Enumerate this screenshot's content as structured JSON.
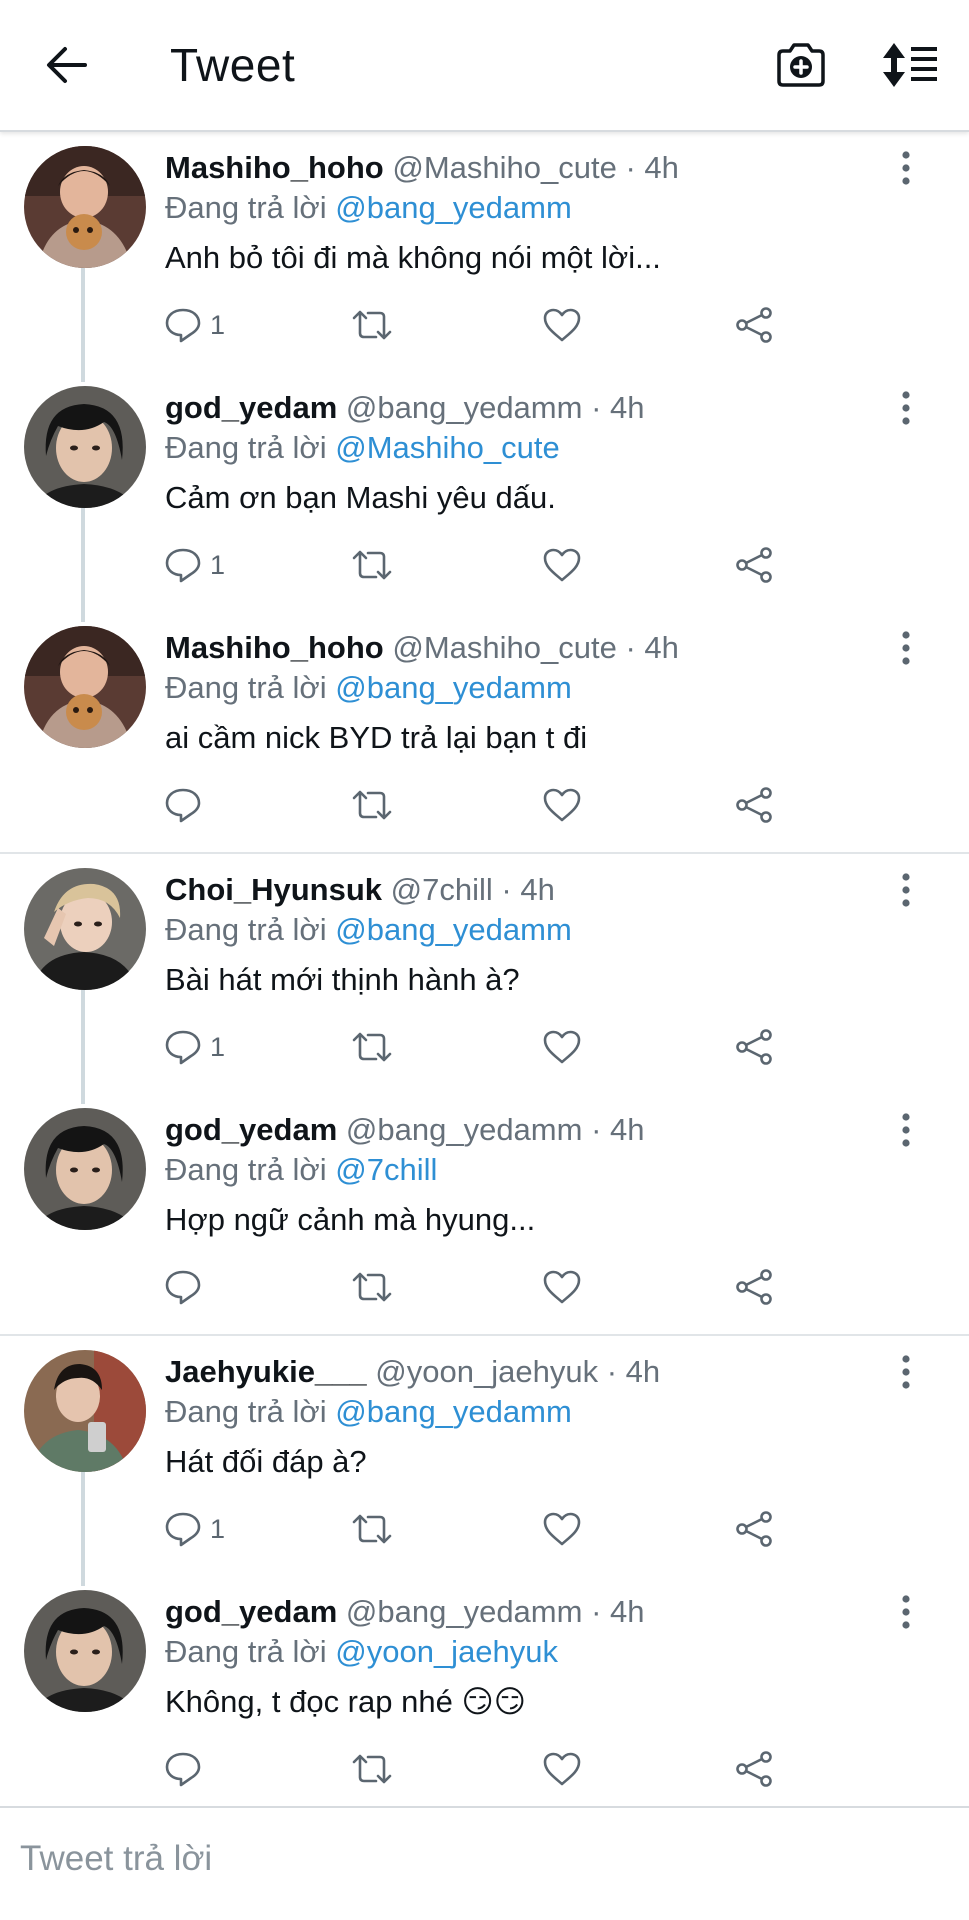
{
  "header": {
    "title": "Tweet",
    "back_icon": "arrow-left-icon",
    "camera_icon": "camera-plus-icon",
    "sort_icon": "sort-icon"
  },
  "colors": {
    "mention": "#2e8fd4",
    "muted": "#66707a",
    "divider": "#e1e5e8",
    "thread_line": "#cfd9de"
  },
  "tweets": [
    {
      "name": "Mashiho_hoho",
      "handle": "@Mashiho_cute",
      "time": "4h",
      "reply_prefix": "Đang trả lời",
      "reply_to": "@bang_yedamm",
      "text": "Anh bỏ tôi đi mà không nói một lời...",
      "reply_count": "1",
      "avatar": "mashiho"
    },
    {
      "name": "god_yedam",
      "handle": "@bang_yedamm",
      "time": "4h",
      "reply_prefix": "Đang trả lời",
      "reply_to": "@Mashiho_cute",
      "text": "Cảm ơn bạn Mashi yêu dấu.",
      "reply_count": "1",
      "avatar": "yedam"
    },
    {
      "name": "Mashiho_hoho",
      "handle": "@Mashiho_cute",
      "time": "4h",
      "reply_prefix": "Đang trả lời",
      "reply_to": "@bang_yedamm",
      "text": "ai cầm nick BYD trả lại bạn t đi",
      "reply_count": "",
      "avatar": "mashiho"
    },
    {
      "name": "Choi_Hyunsuk",
      "handle": "@7chill",
      "time": "4h",
      "reply_prefix": "Đang trả lời",
      "reply_to": "@bang_yedamm",
      "text": "Bài hát mới thịnh hành à?",
      "reply_count": "1",
      "avatar": "hyunsuk"
    },
    {
      "name": "god_yedam",
      "handle": "@bang_yedamm",
      "time": "4h",
      "reply_prefix": "Đang trả lời",
      "reply_to": "@7chill",
      "text": "Hợp ngữ cảnh mà hyung...",
      "reply_count": "",
      "avatar": "yedam"
    },
    {
      "name": "Jaehyukie___",
      "handle": "@yoon_jaehyuk",
      "time": "4h",
      "reply_prefix": "Đang trả lời",
      "reply_to": "@bang_yedamm",
      "text": "Hát đối đáp à?",
      "reply_count": "1",
      "avatar": "jaehyuk"
    },
    {
      "name": "god_yedam",
      "handle": "@bang_yedamm",
      "time": "4h",
      "reply_prefix": "Đang trả lời",
      "reply_to": "@yoon_jaehyuk",
      "text": "Không, t đọc rap nhé 😏😏",
      "reply_count": "",
      "avatar": "yedam"
    }
  ],
  "compose": {
    "placeholder": "Tweet trả lời"
  }
}
